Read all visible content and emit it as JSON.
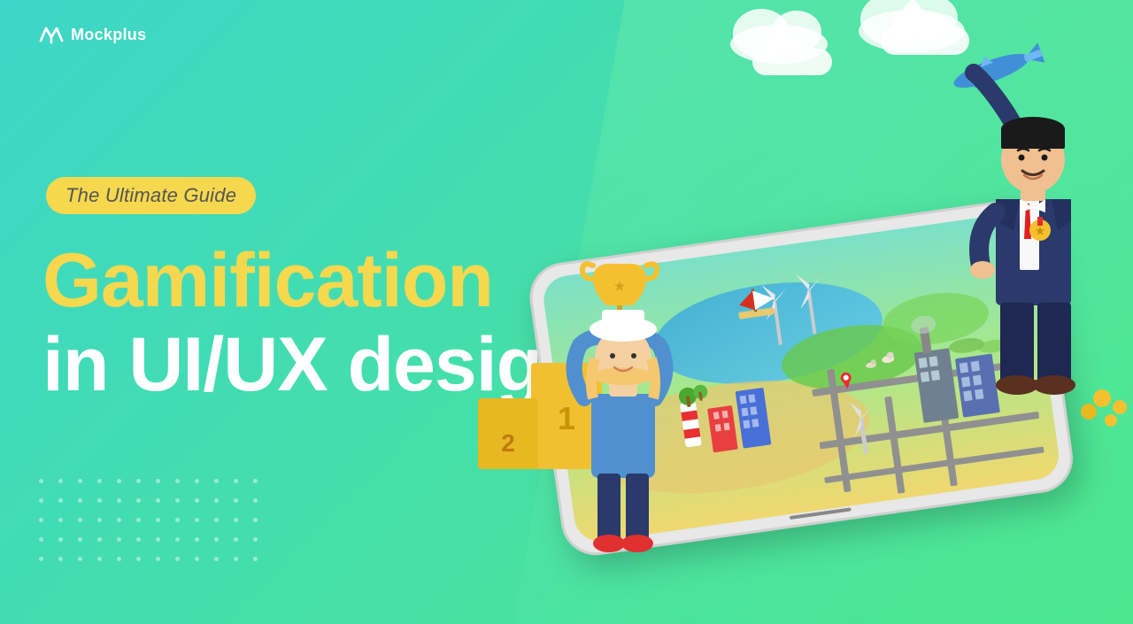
{
  "brand": {
    "name": "Mockplus",
    "logo_alt": "Mockplus logo"
  },
  "hero": {
    "badge_text": "The Ultimate Guide",
    "title_line1": "Gamification",
    "title_line2": "in UI/UX design",
    "background_gradient_start": "#3dd6c8",
    "background_gradient_end": "#4de88a",
    "badge_color": "#f5d84e",
    "title_yellow": "#f5d84e",
    "title_white": "#ffffff"
  },
  "dots": {
    "columns": 12,
    "rows": 5
  }
}
